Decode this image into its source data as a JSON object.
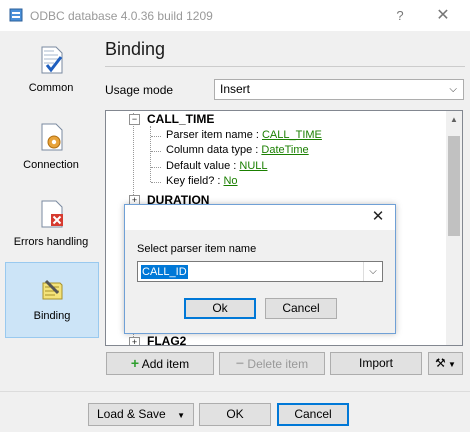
{
  "window": {
    "title": "ODBC database 4.0.36 build 1209",
    "help_glyph": "?",
    "close_glyph": "✕"
  },
  "sidebar": {
    "items": [
      {
        "label": "Common",
        "icon": "document-check-icon"
      },
      {
        "label": "Connection",
        "icon": "document-gear-icon"
      },
      {
        "label": "Errors handling",
        "icon": "document-error-icon"
      },
      {
        "label": "Binding",
        "icon": "binding-pencil-icon",
        "selected": true
      }
    ]
  },
  "main": {
    "title": "Binding",
    "usage_mode": {
      "label": "Usage mode",
      "value": "Insert"
    }
  },
  "tree": {
    "nodes": [
      {
        "name": "CALL_TIME",
        "expanded": true,
        "properties": [
          {
            "label": "Parser item name : ",
            "value": "CALL_TIME"
          },
          {
            "label": "Column data type : ",
            "value": "DateTime"
          },
          {
            "label": "Default value : ",
            "value": "NULL"
          },
          {
            "label": "Key field? : ",
            "value": "No"
          }
        ]
      },
      {
        "name": "DURATION",
        "expanded": false
      },
      {
        "name": "FLAG2",
        "expanded": false
      }
    ]
  },
  "dialog": {
    "label": "Select parser item name",
    "selected_value": "CALL_ID",
    "ok": "Ok",
    "cancel": "Cancel",
    "close_glyph": "✕"
  },
  "tree_actions": {
    "add": "Add item",
    "delete": "Delete item",
    "import": "Import",
    "tools_icon": "tools-icon"
  },
  "footer": {
    "load_save": "Load & Save",
    "ok": "OK",
    "cancel": "Cancel"
  }
}
